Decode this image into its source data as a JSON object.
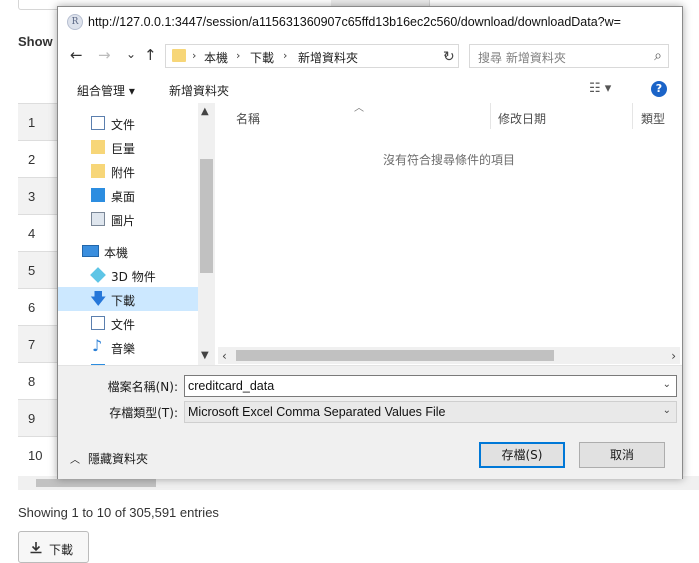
{
  "background": {
    "show_label": "Show",
    "row_numbers": [
      "1",
      "2",
      "3",
      "4",
      "5",
      "6",
      "7",
      "8",
      "9",
      "10"
    ],
    "info_text": "Showing 1 to 10 of 305,591 entries",
    "download_button": "下載"
  },
  "dialog": {
    "app_icon_letter": "R",
    "title": "http://127.0.0.1:3447/session/a115631360907c65ffd13b16ec2c560/download/downloadData?w=",
    "nav": {
      "back": "←",
      "forward": "→",
      "recent": "⌄",
      "up": "↑"
    },
    "breadcrumb": [
      "本機",
      "下載",
      "新增資料夾"
    ],
    "search_placeholder": "搜尋 新增資料夾",
    "toolbar": {
      "organize": "組合管理 ▾",
      "new_folder": "新增資料夾",
      "help": "?"
    },
    "nav_items": [
      {
        "label": "文件"
      },
      {
        "label": "巨量"
      },
      {
        "label": "附件"
      },
      {
        "label": "桌面"
      },
      {
        "label": "圖片"
      },
      {
        "label": "本機"
      },
      {
        "label": "3D 物件"
      },
      {
        "label": "下載",
        "selected": true
      },
      {
        "label": "文件"
      },
      {
        "label": "音樂"
      },
      {
        "label": "桌面"
      }
    ],
    "columns": [
      "名稱",
      "修改日期",
      "類型"
    ],
    "empty_message": "沒有符合搜尋條件的項目",
    "filename_label": "檔案名稱(N):",
    "filename_value": "creditcard_data",
    "filetype_label": "存檔類型(T):",
    "filetype_value": "Microsoft Excel Comma Separated Values File",
    "hide_folders": "隱藏資料夾",
    "save_button": "存檔(S)",
    "cancel_button": "取消"
  }
}
